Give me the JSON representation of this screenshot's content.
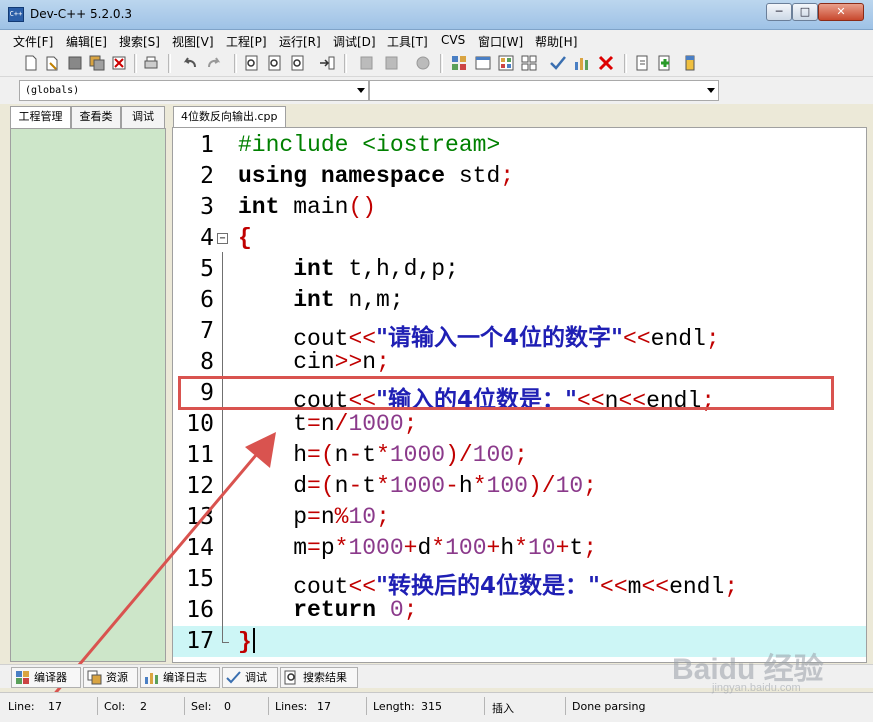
{
  "window": {
    "title": "Dev-C++ 5.2.0.3",
    "minimize": "─",
    "maximize": "□",
    "close": "✕"
  },
  "menu": [
    "文件[F]",
    "编辑[E]",
    "搜索[S]",
    "视图[V]",
    "工程[P]",
    "运行[R]",
    "调试[D]",
    "工具[T]",
    "CVS",
    "窗口[W]",
    "帮助[H]"
  ],
  "combos": {
    "scope": "(globals)",
    "member": ""
  },
  "left_tabs": [
    "工程管理",
    "查看类",
    "调试"
  ],
  "editor_tab": "4位数反向输出.cpp",
  "code_lines": [
    {
      "n": "1"
    },
    {
      "n": "2"
    },
    {
      "n": "3"
    },
    {
      "n": "4"
    },
    {
      "n": "5"
    },
    {
      "n": "6"
    },
    {
      "n": "7"
    },
    {
      "n": "8"
    },
    {
      "n": "9"
    },
    {
      "n": "10"
    },
    {
      "n": "11"
    },
    {
      "n": "12"
    },
    {
      "n": "13"
    },
    {
      "n": "14"
    },
    {
      "n": "15"
    },
    {
      "n": "16"
    },
    {
      "n": "17"
    }
  ],
  "code": {
    "l1_pp": "#include <iostream>",
    "l2_kw1": "using",
    "l2_kw2": "namespace",
    "l2_rest": " std",
    "l2_semi": ";",
    "l3_kw": "int",
    "l3_rest": " main",
    "l3_paren": "()",
    "l4_brace": "{",
    "l5_kw": "int",
    "l5_rest": " t,h,d,p;",
    "l6_kw": "int",
    "l6_rest": " n,m;",
    "l7_a": "cout",
    "l7_op1": "<<",
    "l7_str": "\"请输入一个4位的数字\"",
    "l7_op2": "<<",
    "l7_b": "endl",
    "l7_semi": ";",
    "l8_a": "cin",
    "l8_op": ">>",
    "l8_b": "n",
    "l8_semi": ";",
    "l9_a": "cout",
    "l9_op1": "<<",
    "l9_str": "\"输入的4位数是：\"",
    "l9_op2": "<<",
    "l9_b": "n",
    "l9_op3": "<<",
    "l9_c": "endl",
    "l9_semi": ";",
    "l10": "t=n/1000;",
    "l11": "h=(n-t*1000)/100;",
    "l12": "d=(n-t*1000-h*100)/10;",
    "l13": "p=n%10;",
    "l14": "m=p*1000+d*100+h*10+t;",
    "l15_a": "cout",
    "l15_op1": "<<",
    "l15_str": "\"转换后的4位数是：\"",
    "l15_op2": "<<",
    "l15_b": "m",
    "l15_op3": "<<",
    "l15_c": "endl",
    "l15_semi": ";",
    "l16_kw": "return",
    "l16_num": "0",
    "l16_semi": ";",
    "l17_brace": "}"
  },
  "bottom_tabs": [
    "编译器",
    "资源",
    "编译日志",
    "调试",
    "搜索结果"
  ],
  "status": {
    "line_label": "Line:",
    "line_val": "17",
    "col_label": "Col:",
    "col_val": "2",
    "sel_label": "Sel:",
    "sel_val": "0",
    "lines_label": "Lines:",
    "lines_val": "17",
    "length_label": "Length:",
    "length_val": "315",
    "mode": "插入",
    "message": "Done parsing"
  },
  "watermark": {
    "text": "Baidu 经验",
    "sub": "jingyan.baidu.com"
  },
  "colors": {
    "highlight_box": "#d9534f",
    "arrow": "#d9534f",
    "current_line": "#cdf6f6",
    "project_panel": "#cde6c9"
  }
}
